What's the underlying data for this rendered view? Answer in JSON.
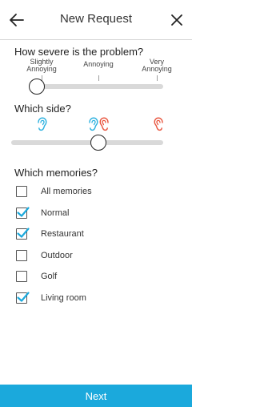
{
  "header": {
    "title": "New Request",
    "back_icon": "arrow-left-icon",
    "close_icon": "close-icon"
  },
  "severity": {
    "title": "How severe is the problem?",
    "labels": [
      {
        "line1": "Slightly",
        "line2": "Annoying"
      },
      {
        "line1": "Annoying",
        "line2": ""
      },
      {
        "line1": "Very",
        "line2": "Annoying"
      }
    ],
    "value_label": "Slightly Annoying"
  },
  "side": {
    "title": "Which side?",
    "left_ear_color": "#2ab0df",
    "right_ear_color": "#e8533c",
    "value": "Both"
  },
  "memories": {
    "title": "Which memories?",
    "items": [
      {
        "label": "All memories",
        "checked": false
      },
      {
        "label": "Normal",
        "checked": true
      },
      {
        "label": "Restaurant",
        "checked": true
      },
      {
        "label": "Outdoor",
        "checked": false
      },
      {
        "label": "Golf",
        "checked": false
      },
      {
        "label": "Living room",
        "checked": true
      }
    ],
    "check_color": "#1ba9dc"
  },
  "footer": {
    "next_label": "Next",
    "bg_color": "#1ba9dc"
  }
}
